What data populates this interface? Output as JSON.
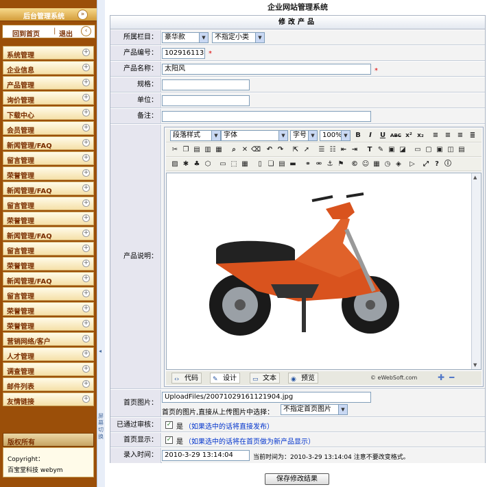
{
  "sidebar": {
    "title": "后台管理系统",
    "toggle_icon": "»",
    "nav": {
      "home": "回到首页",
      "sep": "|",
      "logout": "退出",
      "back_icon": "‹"
    },
    "items": [
      {
        "label": "系统管理"
      },
      {
        "label": "企业信息"
      },
      {
        "label": "产品管理"
      },
      {
        "label": "询价管理"
      },
      {
        "label": "下载中心"
      },
      {
        "label": "会员管理"
      },
      {
        "label": "新闻管理/FAQ"
      },
      {
        "label": "留言管理"
      },
      {
        "label": "荣誉管理"
      },
      {
        "label": "新闻管理/FAQ"
      },
      {
        "label": "留言管理"
      },
      {
        "label": "荣誉管理"
      },
      {
        "label": "新闻管理/FAQ"
      },
      {
        "label": "留言管理"
      },
      {
        "label": "荣誉管理"
      },
      {
        "label": "新闻管理/FAQ"
      },
      {
        "label": "留言管理"
      },
      {
        "label": "荣誉管理"
      },
      {
        "label": "荣誉管理"
      },
      {
        "label": "营销网络/客户"
      },
      {
        "label": "人才管理"
      },
      {
        "label": "调查管理"
      },
      {
        "label": "邮件列表"
      },
      {
        "label": "友情链接"
      }
    ],
    "copyright": {
      "title": "版权所有",
      "line1": "Copyright：",
      "line2": "百宝堂科技 webym"
    }
  },
  "divider": {
    "arrow": "◂",
    "switch_text": "屏幕切换"
  },
  "page_title": "企业网站管理系统",
  "form": {
    "heading": "修改产品",
    "category": {
      "label": "所属栏目：",
      "value": "豪华款",
      "sub_value": "不指定小类"
    },
    "code": {
      "label": "产品编号：",
      "value": "1029161131",
      "required": "*"
    },
    "name": {
      "label": "产品名称：",
      "value": "太阳风",
      "required": "*"
    },
    "spec": {
      "label": "规格：",
      "value": ""
    },
    "unit": {
      "label": "单位：",
      "value": ""
    },
    "remark": {
      "label": "备注：",
      "value": ""
    },
    "description": {
      "label": "产品说明："
    },
    "editor": {
      "style_select": "段落样式",
      "font_select": "字体",
      "size_select": "字号",
      "zoom_select": "100%",
      "format_buttons": [
        "B",
        "I",
        "U",
        "ABC",
        "x²",
        "x₂"
      ],
      "modes": [
        {
          "label": "代码",
          "icon": "‹›"
        },
        {
          "label": "设计",
          "icon": "✎"
        },
        {
          "label": "文本",
          "icon": "▭"
        },
        {
          "label": "预览",
          "icon": "◉"
        }
      ],
      "brand": "© eWebSoft.com",
      "zoom_in_icon": "✚",
      "zoom_out_icon": "━"
    },
    "home_image": {
      "label": "首页图片：",
      "value": "UploadFiles/20071029161121904.jpg",
      "hint": "首页的图片,直接从上传图片中选择：",
      "select": "不指定首页图片"
    },
    "approved": {
      "label": "已通过审核：",
      "text": "是",
      "hint": "（如果选中的话将直接发布）",
      "checked": "✓"
    },
    "homepage": {
      "label": "首页显示：",
      "text": "是",
      "hint": "（如果选中的话将在首页做为新产品显示）",
      "checked": "✓"
    },
    "entry_time": {
      "label": "录入时间：",
      "value": "2010-3-29 13:14:04",
      "note": "当前时间为：2010-3-29 13:14:04 注意不要改变格式。"
    }
  },
  "save_button": "保存修改结果",
  "colors": {
    "sidebar": "#9b4f09",
    "label_bg": "#e6e6ef",
    "accent_blue": "#0033cc",
    "required": "#d00000"
  }
}
